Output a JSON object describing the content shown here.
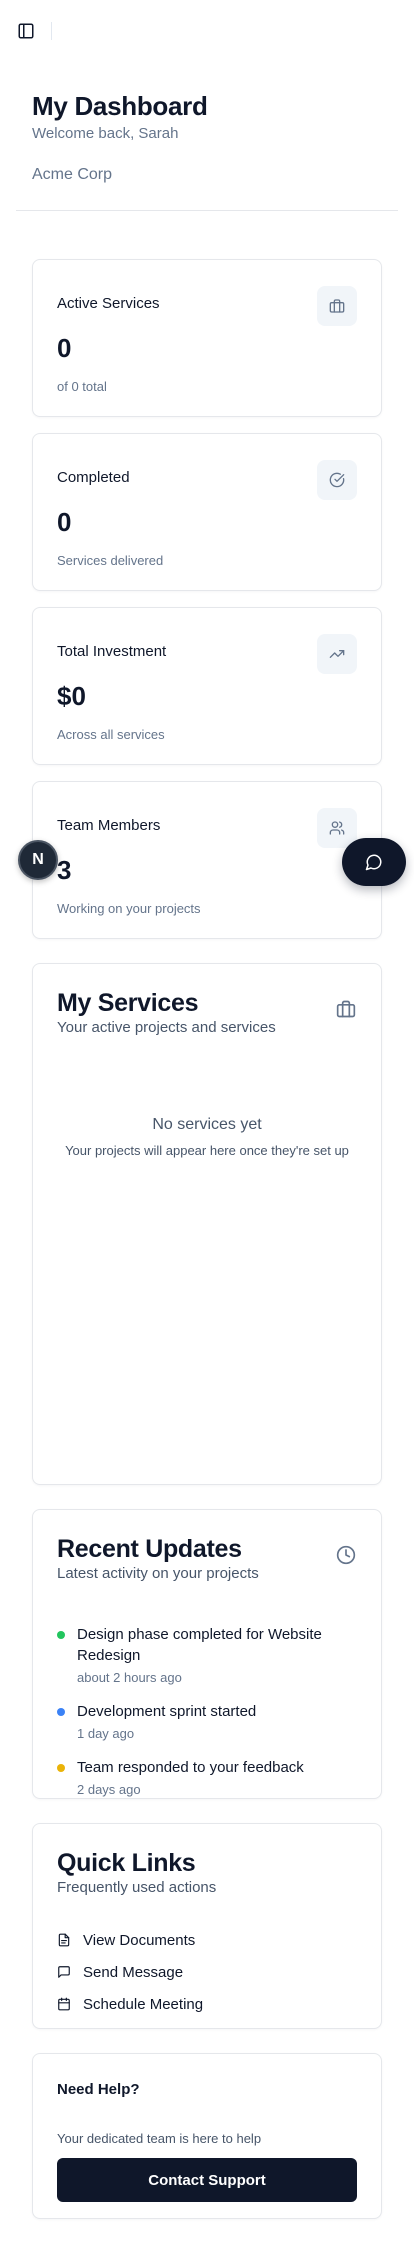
{
  "header": {
    "title": "My Dashboard",
    "welcome": "Welcome back, Sarah",
    "org": "Acme Corp"
  },
  "stats": [
    {
      "label": "Active Services",
      "value": "0",
      "sub": "of 0 total",
      "icon": "briefcase-icon"
    },
    {
      "label": "Completed",
      "value": "0",
      "sub": "Services delivered",
      "icon": "check-circle-icon"
    },
    {
      "label": "Total Investment",
      "value": "$0",
      "sub": "Across all services",
      "icon": "trending-up-icon"
    },
    {
      "label": "Team Members",
      "value": "3",
      "sub": "Working on your projects",
      "icon": "users-icon"
    }
  ],
  "services": {
    "title": "My Services",
    "subtitle": "Your active projects and services",
    "empty_title": "No services yet",
    "empty_sub": "Your projects will appear here once they're set up"
  },
  "updates": {
    "title": "Recent Updates",
    "subtitle": "Latest activity on your projects",
    "items": [
      {
        "title": "Design phase completed for Website Redesign",
        "time": "about 2 hours ago",
        "color": "#22c55e"
      },
      {
        "title": "Development sprint started",
        "time": "1 day ago",
        "color": "#3b82f6"
      },
      {
        "title": "Team responded to your feedback",
        "time": "2 days ago",
        "color": "#eab308"
      }
    ]
  },
  "quick_links": {
    "title": "Quick Links",
    "subtitle": "Frequently used actions",
    "items": [
      {
        "label": "View Documents",
        "icon": "file-icon"
      },
      {
        "label": "Send Message",
        "icon": "message-icon"
      },
      {
        "label": "Schedule Meeting",
        "icon": "calendar-icon"
      }
    ]
  },
  "help": {
    "title": "Need Help?",
    "subtitle": "Your dedicated team is here to help",
    "button": "Contact Support"
  },
  "badge": {
    "letter": "N"
  }
}
